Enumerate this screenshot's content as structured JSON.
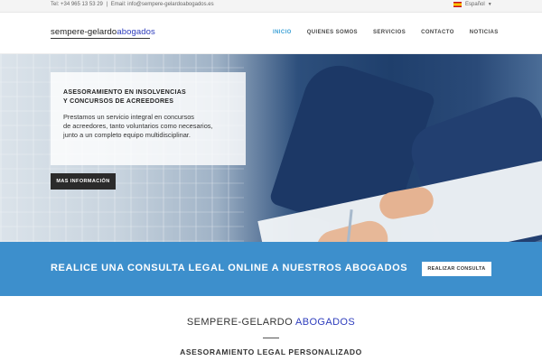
{
  "topbar": {
    "phone": "Tel: +34 965 13 53 29",
    "separator": "|",
    "email": "Email: info@sempere-gelardoabogados.es",
    "language": "Español"
  },
  "header": {
    "logo_part1": "sempere-gelardo",
    "logo_part2": "abogados",
    "nav": [
      "INICIO",
      "QUIENES SOMOS",
      "SERVICIOS",
      "CONTACTO",
      "NOTICIAS"
    ],
    "active_index": 0
  },
  "hero": {
    "title_line1": "ASESORAMIENTO EN INSOLVENCIAS",
    "title_line2": "Y CONCURSOS DE ACREEDORES",
    "text_line1": "Prestamos un servicio integral en concursos",
    "text_line2": "de acreedores, tanto voluntarios como necesarios,",
    "text_line3": "junto a un completo equipo multidisciplinar.",
    "button": "MAS INFORMACIÓN"
  },
  "cta": {
    "text": "REALICE UNA CONSULTA LEGAL ONLINE A NUESTROS ABOGADOS",
    "button": "REALIZAR CONSULTA"
  },
  "section": {
    "brand_part1": "SEMPERE-GELARDO",
    "brand_part2": "ABOGADOS",
    "subtitle": "ASESORAMIENTO LEGAL PERSONALIZADO"
  },
  "colors": {
    "accent_blue": "#3d8fcc",
    "brand_blue": "#2e3dbd",
    "nav_active": "#3ba0d6"
  }
}
